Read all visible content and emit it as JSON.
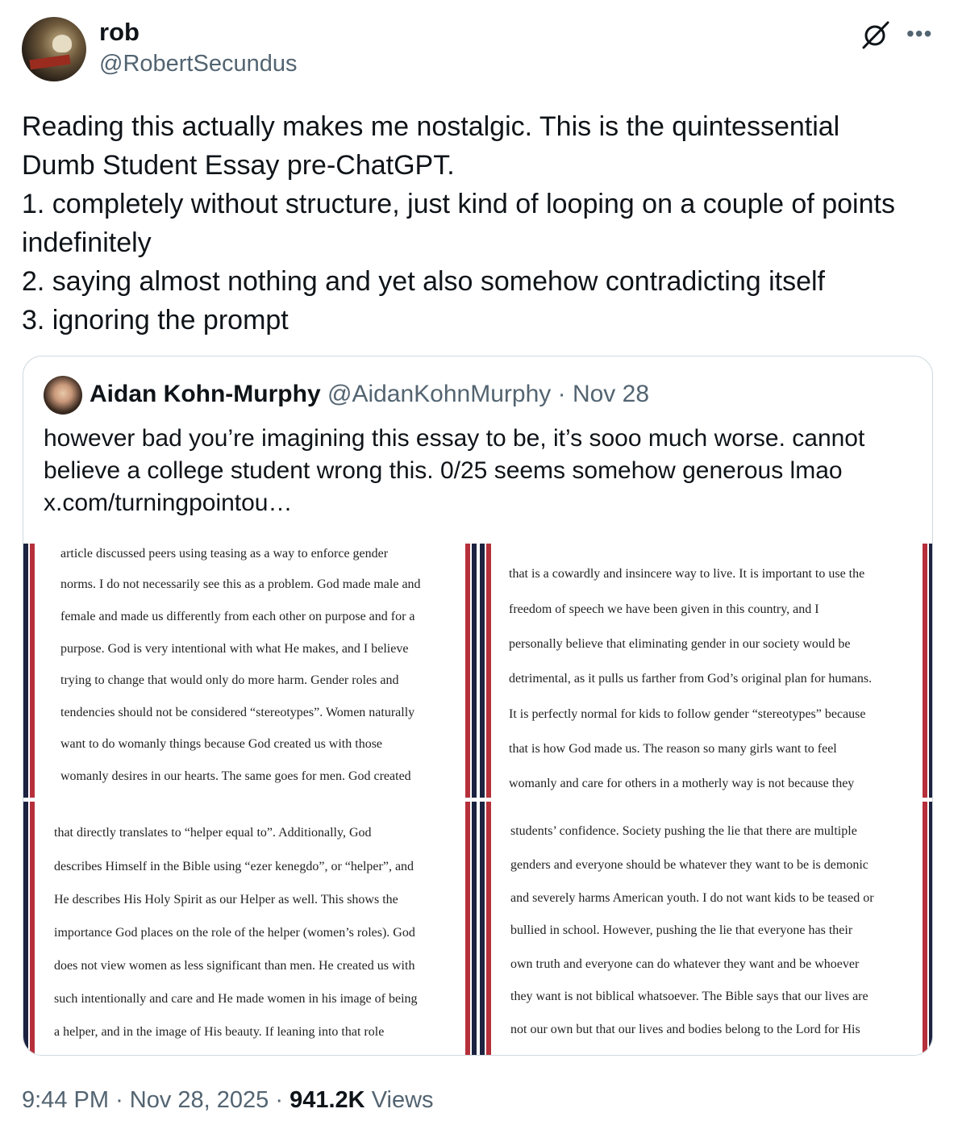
{
  "author": {
    "name": "rob",
    "handle": "@RobertSecundus"
  },
  "icons": {
    "grok": "grok-icon",
    "more": "more-icon"
  },
  "tweet": {
    "lines": [
      "Reading this actually makes me nostalgic. This is the quintessential",
      "Dumb Student Essay pre-ChatGPT.",
      "1. completely without structure, just kind of looping on a couple of points",
      "indefinitely",
      "2. saying almost nothing and yet also somehow contradicting itself",
      "3. ignoring the prompt"
    ]
  },
  "quote": {
    "name": "Aidan Kohn-Murphy",
    "handle": "@AidanKohnMurphy",
    "separator": "·",
    "date": "Nov 28",
    "lines": [
      "however bad you’re imagining this essay to be, it’s sooo much worse. cannot",
      "believe a college student wrong this. 0/25 seems somehow generous lmao",
      "x.com/turningpointou…"
    ],
    "images": [
      {
        "lines": [
          "article discussed peers using teasing as a way to enforce gender",
          "norms. I do not necessarily see this as a problem. God made male and",
          "female and made us differently from each other on purpose and for a",
          "purpose. God is very intentional with what He makes, and I believe",
          "trying to change that would only do more harm. Gender roles and",
          "tendencies should not be considered “stereotypes”. Women naturally",
          "want to do womanly things because God created us with those",
          "womanly desires in our hearts. The same goes for men. God created"
        ]
      },
      {
        "lines": [
          "that is a cowardly and insincere way to live. It is important to use the",
          "freedom of speech we have been given in this country, and I",
          "personally believe that eliminating gender in our society would be",
          "detrimental, as it pulls us farther from God’s original plan for humans.",
          "It is perfectly normal for kids to follow gender “stereotypes” because",
          "that is how God made us. The reason so many girls want to feel",
          "womanly and care for others in a motherly way is not because they"
        ]
      },
      {
        "lines": [
          "that directly translates to “helper equal to”. Additionally, God",
          "describes Himself in the Bible using “ezer kenegdo”, or “helper”, and",
          "He describes His Holy Spirit as our Helper as well. This shows the",
          "importance God places on the role of the helper (women’s roles). God",
          "does not view women as less significant than men. He created us with",
          "such intentionally and care and He made women in his image of being",
          "a helper, and in the image of His beauty. If leaning into that role"
        ]
      },
      {
        "lines": [
          "students’ confidence. Society pushing the lie that there are multiple",
          "genders and everyone should be whatever they want to be is demonic",
          "and severely harms American youth. I do not want kids to be teased or",
          "bullied in school. However, pushing the lie that everyone has their",
          "own truth and everyone can do whatever they want and be whoever",
          "they want is not biblical whatsoever. The Bible says that our lives are",
          "not our own but that our lives and bodies belong to the Lord for His"
        ]
      }
    ]
  },
  "footer": {
    "time": "9:44 PM",
    "sep1": "·",
    "date": "Nov 28, 2025",
    "sep2": "·",
    "views_count": "941.2K",
    "views_label": "Views"
  }
}
